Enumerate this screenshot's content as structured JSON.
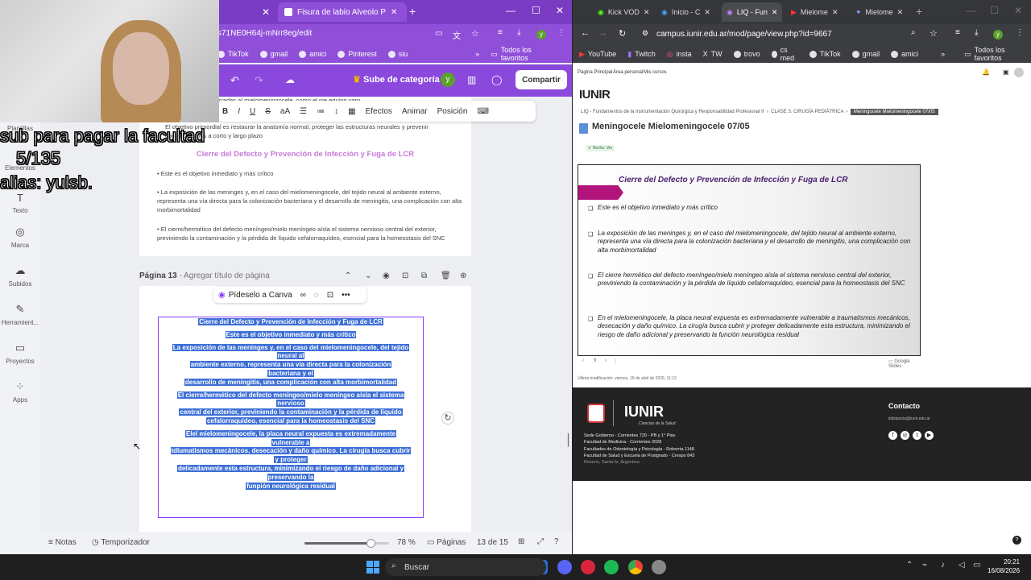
{
  "left_browser": {
    "tabs": [
      {
        "label": "Fisura de labio Alveolo Palatina"
      }
    ],
    "url": "s71NE0H64j-mNrr8eg/edit",
    "bookmarks": [
      "TikTok",
      "gmail",
      "amici",
      "Pinterest",
      "siu"
    ],
    "bookmarks_folder": "Todos los favoritos",
    "avatar_letter": "y"
  },
  "canva": {
    "upgrade_label": "Sube de categoría",
    "share_label": "Compartir",
    "text_toolbar": {
      "bold": "B",
      "italic": "I",
      "underline": "U",
      "strike": "S",
      "case": "aA",
      "effects": "Efectos",
      "animate": "Animar",
      "position": "Posición"
    },
    "sidebar": [
      {
        "icon": "template-icon",
        "label": "Plantillas"
      },
      {
        "icon": "elements-icon",
        "label": "Elementos"
      },
      {
        "icon": "text-icon",
        "label": "Texto"
      },
      {
        "icon": "brand-icon",
        "label": "Marca"
      },
      {
        "icon": "upload-icon",
        "label": "Subidos"
      },
      {
        "icon": "tools-icon",
        "label": "Herramient..."
      },
      {
        "icon": "folder-icon",
        "label": "Proyectos"
      },
      {
        "icon": "apps-icon",
        "label": "Apps"
      }
    ],
    "page12": {
      "top_text": "s comunes de los pies asociadas al mielomeningocele, como el pie equino varo",
      "objective": "El objetivo primordial es restaurar la anatomía normal, proteger las estructuras neurales y prevenir complicaciones a corto y largo plazo",
      "title": "Cierre del Defecto y Prevención de Infección y Fuga de LCR",
      "bullets": [
        "Este es el objetivo inmediato y más crítico",
        "La exposición de las meninges y, en el caso del mielomeningocele, del tejido neural al ambiente externo, representa una vía directa para la colonización bacteriana y el desarrollo de meningitis, una complicación con alta morbimortalidad",
        "El cierre/hermético del defecto meníngeo/mielo meníngeo aísla el sistema nervioso central del exterior, previniendo la contaminación y la pérdida de líquido cefalorraquídeo, esencial para la homeostasis del SNC"
      ]
    },
    "page13": {
      "label": "Página 13",
      "add_title": "Agregar título de página",
      "ask_canva": "Pídeselo a Canva",
      "selected_lines": [
        "Cierre del Defecto y Prevención de Infección y Fuga de LCR",
        "",
        "Este es el objetivo inmediato y más crítico",
        "",
        "La exposición de las meninges y, en el caso del mielomeningocele, del tejido",
        "neural al",
        "ambiente externo, representa una vía directa para la colonización",
        "bacteriana y el",
        "desarrollo de meningitis, una complicación con alta morbimortalidad",
        "",
        "El cierre/hermético del defecto meníngeo/mielo meníngeo aísla el sistema",
        "nervioso",
        "central del exterior, previniendo la contaminación y la pérdida de líquido",
        "cefalorraquídeo, esencial para la homeostasis del SNC",
        "",
        "Elel mielomeningocele, la placa neural expuesta es extremadamente",
        "vulnerable a",
        "tdlumatismos mecánicos, desecación y daño químico. La cirugía busca cubrir",
        "y proteger",
        "delicadamente esta estructura, minimizando el riesgo de daño adicional y",
        "preservando la",
        "funpión neurológica residual"
      ]
    },
    "bottom": {
      "notes": "Notas",
      "timer": "Temporizador",
      "zoom": "78 %",
      "pages_label": "Páginas",
      "page_count": "13 de 15",
      "zoom_value": 0.78
    }
  },
  "stream_overlay": {
    "line1": "sub para pagar la facultad",
    "line2": "5/135",
    "line3": "alias: yulsb."
  },
  "right_browser": {
    "tabs": [
      "Kick VOD",
      "Inicio - C",
      "LIQ - Fun",
      "Mielome",
      "Mielome"
    ],
    "url": "campus.iunir.edu.ar/mod/page/view.php?id=9667",
    "bookmarks": [
      "YouTube",
      "Twitch",
      "insta",
      "TW",
      "trovo",
      "cs med",
      "TikTok",
      "gmail",
      "amici"
    ],
    "bookmarks_folder": "Todos los favoritos",
    "avatar_letter": "y"
  },
  "moodle": {
    "nav": [
      "Página Principal",
      "Área personal",
      "Mis cursos"
    ],
    "logo_text": "IUNIR",
    "breadcrumb": [
      "LIQ - Fundamentos de la Instrumentación Quirúrgica y Responsabilidad Profesional II",
      "CLASE 3. CIRUGÍA PEDIÁTRICA",
      "Meningocele Mielomeningocele 07/05"
    ],
    "title": "Meningocele Mielomeningocele 07/05",
    "done_badge": "Hecho: Ver",
    "slide": {
      "title": "Cierre del Defecto y Prevención de Infección y Fuga de LCR",
      "items": [
        "Este es el objetivo inmediato y más crítico",
        "La exposición de las meninges y, en el caso del mielomeningocele, del tejido neural al ambiente externo, representa una vía directa para la colonización bacteriana y el desarrollo de meningitis, una complicación con alta morbimortalidad",
        "El cierre hermético del defecto meníngeo/mielo meníngeo aísla el sistema nervioso central del exterior, previniendo la contaminación y la pérdida de líquido cefalorraquídeo, esencial para la homeostasis del SNC",
        "En el mielomeningocele, la placa neural expuesta es extremadamente vulnerable a traumatismos mecánicos, desecación y daño químico. La cirugía busca cubrir y proteger delicadamente esta estructura, minimizando el riesgo de daño adicional y preservando la función neurológica residual"
      ],
      "page_num": "9",
      "google_slides": "Google Slides"
    },
    "last_modified": "Última modificación: viernes, 18 de abril de 2025, 11:12",
    "footer": {
      "contact": "Contacto",
      "email": "iidistancia@iunir.edu.ar",
      "logo": "IUNIR",
      "subtitle": "Ciencias de la Salud",
      "lines": [
        "Sede Gobierno - Corrientes 720 - PB y 1° Piso",
        "Facultad de Medicina - Corrientes 2028",
        "Facultades de Odontología y Psicología - Roberrta 1148",
        "Facultad de Salud y Escuela de Postgrado - Crespo 843",
        "Rosario, Santa fe, Argentina"
      ]
    }
  },
  "taskbar": {
    "search": "Buscar",
    "time": "20:21",
    "date": "16/08/2026"
  },
  "colors": {
    "canva_purple": "#8f4fd8",
    "selection_blue": "#3d6fd6",
    "moodle_footer": "#232323"
  }
}
